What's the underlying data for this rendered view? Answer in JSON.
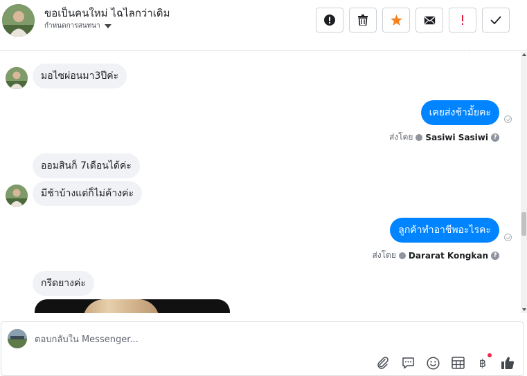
{
  "header": {
    "title": "ขอเป็นคนใหม่ ไฉไลกว่าเดิม",
    "subtitle": "กำหนดการสนทนา"
  },
  "messages": {
    "m1": "มอไซผ่อนมา3ปีค่ะ",
    "m2": "เคยส่งช้ามั้ยคะ",
    "m2_sent_prefix": "ส่งโดย",
    "m2_sender": "Sasiwi Sasiwi",
    "m3": "ออมสินก็ 7เดือนได้ค่ะ",
    "m4": "มีช้าบ้างแต่ก็ไม่ค้างค่ะ",
    "m5": "ลูกค้าทำอาชีพอะไรคะ",
    "m5_sent_prefix": "ส่งโดย",
    "m5_sender": "Dararat Kongkan",
    "m6": "กรีดยางค่ะ"
  },
  "composer": {
    "placeholder": "ตอบกลับใน Messenger...",
    "baht_symbol": "฿"
  },
  "colors": {
    "accent": "#0084ff",
    "incoming_bubble": "#f0f2f5",
    "star": "#f5821f",
    "alert": "#e41e3f"
  },
  "icons": [
    "avatar",
    "exclamation-circle-icon",
    "trash-icon",
    "star-icon",
    "envelope-icon",
    "exclamation-icon",
    "check-icon",
    "paperclip-icon",
    "chat-bubble-icon",
    "smiley-icon",
    "table-icon",
    "baht-icon",
    "thumbs-up-icon"
  ]
}
